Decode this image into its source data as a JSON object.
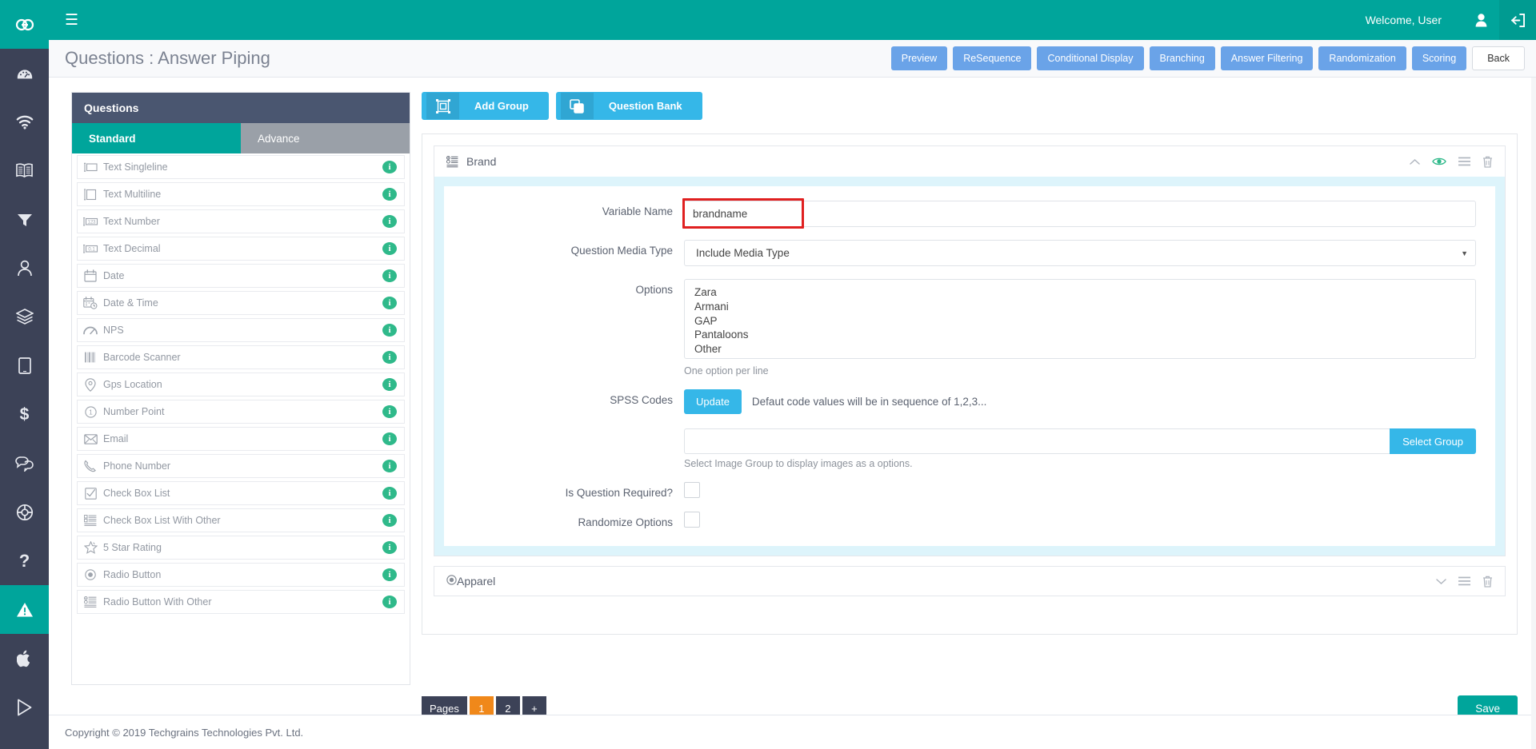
{
  "topbar": {
    "logo": "go-logo-icon",
    "menu_icon": "hamburger-icon",
    "welcome": "Welcome, User",
    "user_icon": "user-icon",
    "logout_icon": "logout-icon"
  },
  "page": {
    "title": "Questions : Answer Piping"
  },
  "header_actions": [
    {
      "label": "Preview",
      "name": "preview-button",
      "style": "blue"
    },
    {
      "label": "ReSequence",
      "name": "resequence-button",
      "style": "blue"
    },
    {
      "label": "Conditional Display",
      "name": "conditional-display-button",
      "style": "blue"
    },
    {
      "label": "Branching",
      "name": "branching-button",
      "style": "blue"
    },
    {
      "label": "Answer Filtering",
      "name": "answer-filtering-button",
      "style": "blue"
    },
    {
      "label": "Randomization",
      "name": "randomization-button",
      "style": "blue"
    },
    {
      "label": "Scoring",
      "name": "scoring-button",
      "style": "blue"
    },
    {
      "label": "Back",
      "name": "back-button",
      "style": "ghost"
    }
  ],
  "rail": {
    "items": [
      {
        "icon": "dashboard-gauge-icon",
        "active": false
      },
      {
        "icon": "wifi-icon",
        "active": false
      },
      {
        "icon": "book-icon",
        "active": false
      },
      {
        "icon": "filter-funnel-icon",
        "active": false
      },
      {
        "icon": "user-profile-icon",
        "active": false
      },
      {
        "icon": "layers-icon",
        "active": false
      },
      {
        "icon": "tablet-icon",
        "active": false
      },
      {
        "icon": "dollar-icon",
        "active": false
      },
      {
        "icon": "chat-bubbles-icon",
        "active": false
      },
      {
        "icon": "lifebuoy-icon",
        "active": false
      },
      {
        "icon": "question-mark-icon",
        "active": false
      },
      {
        "icon": "warning-triangle-icon",
        "active": true
      },
      {
        "icon": "apple-icon",
        "active": false
      },
      {
        "icon": "play-store-icon",
        "active": false
      }
    ]
  },
  "questions_panel": {
    "heading": "Questions",
    "tabs": [
      {
        "label": "Standard",
        "active": true
      },
      {
        "label": "Advance",
        "active": false
      }
    ],
    "types": [
      {
        "label": "Text Singleline",
        "icon": "text-singleline-icon"
      },
      {
        "label": "Text Multiline",
        "icon": "text-multiline-icon"
      },
      {
        "label": "Text Number",
        "icon": "text-number-icon"
      },
      {
        "label": "Text Decimal",
        "icon": "text-decimal-icon"
      },
      {
        "label": "Date",
        "icon": "calendar-icon"
      },
      {
        "label": "Date & Time",
        "icon": "calendar-clock-icon"
      },
      {
        "label": "NPS",
        "icon": "gauge-icon"
      },
      {
        "label": "Barcode Scanner",
        "icon": "barcode-icon"
      },
      {
        "label": "Gps Location",
        "icon": "map-pin-icon"
      },
      {
        "label": "Number Point",
        "icon": "number-circle-icon"
      },
      {
        "label": "Email",
        "icon": "envelope-icon"
      },
      {
        "label": "Phone Number",
        "icon": "phone-icon"
      },
      {
        "label": "Check Box List",
        "icon": "checkbox-icon"
      },
      {
        "label": "Check Box List With Other",
        "icon": "checkbox-list-other-icon"
      },
      {
        "label": "5 Star Rating",
        "icon": "star-icon"
      },
      {
        "label": "Radio Button",
        "icon": "radio-icon"
      },
      {
        "label": "Radio Button With Other",
        "icon": "radio-list-other-icon"
      }
    ],
    "info_badge": "i"
  },
  "editor": {
    "toolbar": [
      {
        "label": "Add Group",
        "icon": "group-frame-icon",
        "name": "add-group-button"
      },
      {
        "label": "Question Bank",
        "icon": "copy-stack-icon",
        "name": "question-bank-button"
      }
    ],
    "question": {
      "title": "Brand",
      "type_icon": "radio-list-other-icon",
      "tools": [
        {
          "icon": "chevron-up-icon",
          "name": "collapse-question-toggle"
        },
        {
          "icon": "eye-icon",
          "name": "preview-question-button"
        },
        {
          "icon": "list-menu-icon",
          "name": "question-menu-button"
        },
        {
          "icon": "trash-icon",
          "name": "delete-question-button"
        }
      ],
      "fields": {
        "variable_name_label": "Variable Name",
        "variable_name_value": "brandname",
        "variable_name_placeholder": "",
        "media_type_label": "Question Media Type",
        "media_type_value": "Include Media Type",
        "options_label": "Options",
        "options_value": "Zara\nArmani\nGAP\nPantaloons\nOther",
        "options_help": "One option per line",
        "spss_label": "SPSS Codes",
        "spss_update_label": "Update",
        "spss_note": "Defaut code values will be in sequence of 1,2,3...",
        "image_group_value": "",
        "image_group_placeholder": "",
        "select_group_label": "Select Group",
        "image_group_help": "Select Image Group to display images as a options.",
        "required_label": "Is Question Required?",
        "required_checked": false,
        "randomize_label": "Randomize Options",
        "randomize_checked": false
      }
    },
    "collapsed_question": {
      "title": "Apparel",
      "type_icon": "radio-icon",
      "tools": [
        {
          "icon": "chevron-down-icon",
          "name": "expand-question-toggle"
        },
        {
          "icon": "list-menu-icon",
          "name": "question-menu-button"
        },
        {
          "icon": "trash-icon",
          "name": "delete-question-button"
        }
      ]
    }
  },
  "pager": {
    "label": "Pages",
    "pages": [
      {
        "label": "1",
        "active": true
      },
      {
        "label": "2",
        "active": false
      }
    ],
    "add_label": "+",
    "save_label": "Save"
  },
  "footer": {
    "copyright": "Copyright © 2019 Techgrains Technologies Pvt. Ltd."
  },
  "colors": {
    "teal": "#00a59b",
    "navy": "#3c4257",
    "panel_head": "#4a5670",
    "blue_button": "#6aa3e8",
    "cyan_button": "#35b7e8",
    "orange": "#f0881a",
    "green_badge": "#2fb98a",
    "highlight_red": "#e02020",
    "question_body": "#ddf4fb"
  }
}
